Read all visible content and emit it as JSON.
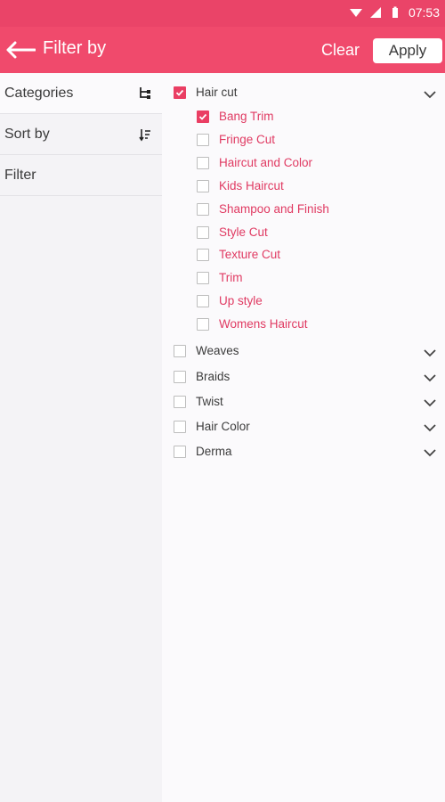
{
  "status": {
    "time": "07:53"
  },
  "appbar": {
    "title": "Filter by",
    "clear_label": "Clear",
    "apply_label": "Apply"
  },
  "tabs": [
    {
      "label": "Categories",
      "icon": "tree-icon"
    },
    {
      "label": "Sort by",
      "icon": "sort-icon"
    },
    {
      "label": "Filter"
    }
  ],
  "categories": [
    {
      "label": "Hair cut",
      "checked": true,
      "expanded": true,
      "items": [
        {
          "label": "Bang Trim",
          "checked": true
        },
        {
          "label": "Fringe Cut",
          "checked": false
        },
        {
          "label": "Haircut and Color",
          "checked": false
        },
        {
          "label": "Kids Haircut",
          "checked": false
        },
        {
          "label": "Shampoo and Finish",
          "checked": false
        },
        {
          "label": "Style Cut",
          "checked": false
        },
        {
          "label": "Texture Cut",
          "checked": false
        },
        {
          "label": "Trim",
          "checked": false
        },
        {
          "label": "Up style",
          "checked": false
        },
        {
          "label": "Womens Haircut",
          "checked": false
        }
      ]
    },
    {
      "label": "Weaves",
      "checked": false
    },
    {
      "label": "Braids",
      "checked": false
    },
    {
      "label": "Twist",
      "checked": false
    },
    {
      "label": "Hair Color",
      "checked": false
    },
    {
      "label": "Derma",
      "checked": false
    }
  ],
  "colors": {
    "accent": "#f04a6c",
    "status_bar": "#ea4468",
    "sub_item_text": "#e03a62"
  }
}
